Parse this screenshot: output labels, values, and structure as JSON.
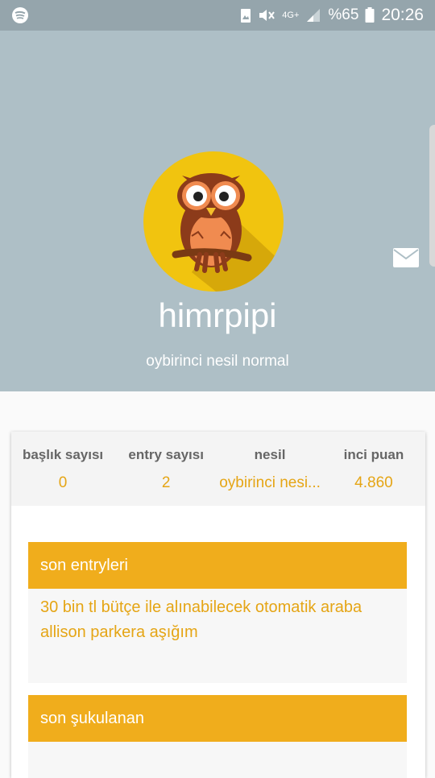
{
  "status_bar": {
    "app_icon": "spotify-icon",
    "network": "4G+",
    "battery_text": "%65",
    "time": "20:26",
    "icons": [
      "image-icon",
      "mute-icon",
      "network-icon",
      "signal-icon",
      "battery-icon"
    ]
  },
  "profile": {
    "username": "himrpipi",
    "subtitle": "oybirinci nesil normal",
    "avatar": "owl-avatar",
    "mail_icon": "mail-icon",
    "header_color": "#aebfc6",
    "avatar_bg": "#f1c40f"
  },
  "stats": {
    "baslik": {
      "label": "başlık sayısı",
      "value": "0"
    },
    "entry": {
      "label": "entry sayısı",
      "value": "2"
    },
    "nesil": {
      "label": "nesil",
      "value": "oybirinci nesi..."
    },
    "inci": {
      "label": "inci puan",
      "value": "4.860"
    }
  },
  "sections": {
    "son_entryleri": {
      "title": "son entryleri",
      "items": [
        "30 bin tl bütçe ile alınabilecek otomatik araba",
        "allison parkera aşığım"
      ]
    },
    "son_sukulanan": {
      "title": "son şukulanan"
    }
  },
  "colors": {
    "accent": "#f0ad1c",
    "accent_text": "#e5a515"
  }
}
